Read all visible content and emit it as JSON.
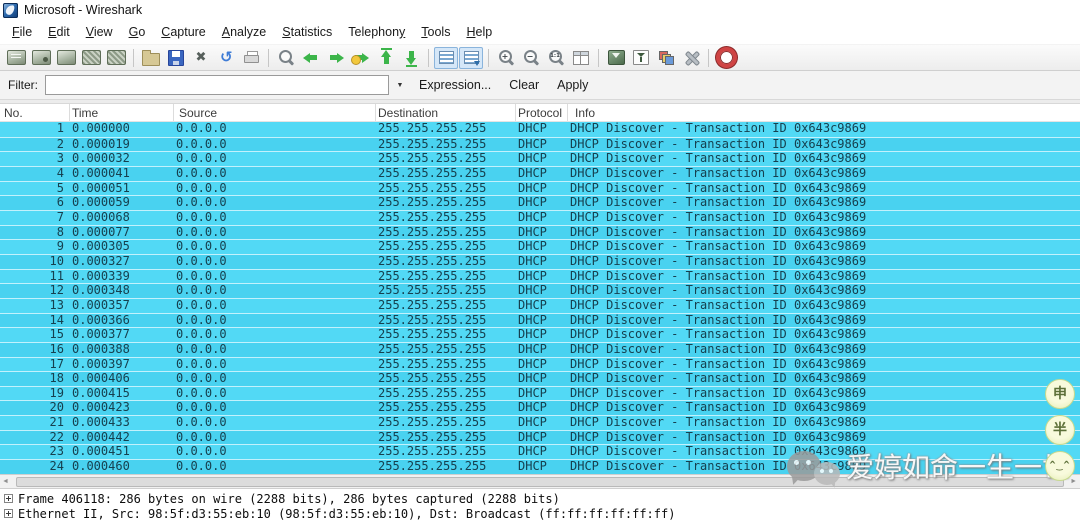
{
  "window": {
    "title": "Microsoft - Wireshark"
  },
  "menu": {
    "items": [
      {
        "label": "File",
        "underline": 0
      },
      {
        "label": "Edit",
        "underline": 0
      },
      {
        "label": "View",
        "underline": 0
      },
      {
        "label": "Go",
        "underline": 0
      },
      {
        "label": "Capture",
        "underline": 0
      },
      {
        "label": "Analyze",
        "underline": 0
      },
      {
        "label": "Statistics",
        "underline": 0
      },
      {
        "label": "Telephony",
        "underline": 8
      },
      {
        "label": "Tools",
        "underline": 0
      },
      {
        "label": "Help",
        "underline": 0
      }
    ]
  },
  "toolbar": {
    "buttons": [
      {
        "name": "list-interfaces",
        "type": "cap1"
      },
      {
        "name": "capture-options",
        "type": "cap2"
      },
      {
        "name": "capture-start",
        "type": "cap3"
      },
      {
        "name": "capture-stop",
        "type": "cap4"
      },
      {
        "name": "capture-restart",
        "type": "cap5"
      },
      {
        "type": "sep"
      },
      {
        "name": "open-capture-file",
        "type": "folder"
      },
      {
        "name": "save-capture-file",
        "type": "floppy"
      },
      {
        "name": "close-capture-file",
        "type": "close",
        "glyph": "✖"
      },
      {
        "name": "reload-capture-file",
        "type": "reload",
        "glyph": "↻"
      },
      {
        "name": "print-packets",
        "type": "printer"
      },
      {
        "type": "sep"
      },
      {
        "name": "find-packet",
        "type": "find"
      },
      {
        "name": "go-back",
        "type": "arrow-left"
      },
      {
        "name": "go-forward",
        "type": "arrow-right"
      },
      {
        "name": "go-to-packet",
        "type": "arrow-jump"
      },
      {
        "name": "go-first-packet",
        "type": "arrow-top"
      },
      {
        "name": "go-last-packet",
        "type": "arrow-bottom"
      },
      {
        "type": "sep"
      },
      {
        "name": "colorize-packet-list",
        "type": "toggle-colorize",
        "toggled": true
      },
      {
        "name": "auto-scroll-in-live-capture",
        "type": "toggle-autoscroll",
        "toggled": true
      },
      {
        "type": "sep"
      },
      {
        "name": "zoom-in",
        "type": "zoom",
        "glyph": "+"
      },
      {
        "name": "zoom-out",
        "type": "zoom",
        "glyph": "−"
      },
      {
        "name": "zoom-100",
        "type": "zoom",
        "glyph": "1:1"
      },
      {
        "name": "resize-columns",
        "type": "resize"
      },
      {
        "type": "sep"
      },
      {
        "name": "capture-filters",
        "type": "cfilter"
      },
      {
        "name": "display-filters",
        "type": "dfilter"
      },
      {
        "name": "coloring-rules",
        "type": "colrules"
      },
      {
        "name": "preferences",
        "type": "prefs"
      },
      {
        "type": "sep"
      },
      {
        "name": "help-contents",
        "type": "help"
      }
    ]
  },
  "filter_bar": {
    "label": "Filter:",
    "input_value": "",
    "dropdown_icon": "▼",
    "expression_label": "Expression...",
    "clear_label": "Clear",
    "apply_label": "Apply"
  },
  "packet_list": {
    "columns": [
      "No.",
      "Time",
      "Source",
      "Destination",
      "Protocol",
      "Info"
    ],
    "common": {
      "source": "0.0.0.0",
      "destination": "255.255.255.255",
      "protocol": "DHCP",
      "info": "DHCP Discover - Transaction ID 0x643c9869"
    },
    "rows": [
      {
        "no": "1",
        "time": "0.000000",
        "source": "0.0.0.0",
        "destination": "255.255.255.255",
        "protocol": "DHCP",
        "info": "DHCP Discover - Transaction ID 0x643c9869"
      },
      {
        "no": "2",
        "time": "0.000019",
        "source": "0.0.0.0",
        "destination": "255.255.255.255",
        "protocol": "DHCP",
        "info": "DHCP Discover - Transaction ID 0x643c9869"
      },
      {
        "no": "3",
        "time": "0.000032",
        "source": "0.0.0.0",
        "destination": "255.255.255.255",
        "protocol": "DHCP",
        "info": "DHCP Discover - Transaction ID 0x643c9869"
      },
      {
        "no": "4",
        "time": "0.000041",
        "source": "0.0.0.0",
        "destination": "255.255.255.255",
        "protocol": "DHCP",
        "info": "DHCP Discover - Transaction ID 0x643c9869"
      },
      {
        "no": "5",
        "time": "0.000051",
        "source": "0.0.0.0",
        "destination": "255.255.255.255",
        "protocol": "DHCP",
        "info": "DHCP Discover - Transaction ID 0x643c9869"
      },
      {
        "no": "6",
        "time": "0.000059",
        "source": "0.0.0.0",
        "destination": "255.255.255.255",
        "protocol": "DHCP",
        "info": "DHCP Discover - Transaction ID 0x643c9869"
      },
      {
        "no": "7",
        "time": "0.000068",
        "source": "0.0.0.0",
        "destination": "255.255.255.255",
        "protocol": "DHCP",
        "info": "DHCP Discover - Transaction ID 0x643c9869"
      },
      {
        "no": "8",
        "time": "0.000077",
        "source": "0.0.0.0",
        "destination": "255.255.255.255",
        "protocol": "DHCP",
        "info": "DHCP Discover - Transaction ID 0x643c9869"
      },
      {
        "no": "9",
        "time": "0.000305",
        "source": "0.0.0.0",
        "destination": "255.255.255.255",
        "protocol": "DHCP",
        "info": "DHCP Discover - Transaction ID 0x643c9869"
      },
      {
        "no": "10",
        "time": "0.000327",
        "source": "0.0.0.0",
        "destination": "255.255.255.255",
        "protocol": "DHCP",
        "info": "DHCP Discover - Transaction ID 0x643c9869"
      },
      {
        "no": "11",
        "time": "0.000339",
        "source": "0.0.0.0",
        "destination": "255.255.255.255",
        "protocol": "DHCP",
        "info": "DHCP Discover - Transaction ID 0x643c9869"
      },
      {
        "no": "12",
        "time": "0.000348",
        "source": "0.0.0.0",
        "destination": "255.255.255.255",
        "protocol": "DHCP",
        "info": "DHCP Discover - Transaction ID 0x643c9869"
      },
      {
        "no": "13",
        "time": "0.000357",
        "source": "0.0.0.0",
        "destination": "255.255.255.255",
        "protocol": "DHCP",
        "info": "DHCP Discover - Transaction ID 0x643c9869"
      },
      {
        "no": "14",
        "time": "0.000366",
        "source": "0.0.0.0",
        "destination": "255.255.255.255",
        "protocol": "DHCP",
        "info": "DHCP Discover - Transaction ID 0x643c9869"
      },
      {
        "no": "15",
        "time": "0.000377",
        "source": "0.0.0.0",
        "destination": "255.255.255.255",
        "protocol": "DHCP",
        "info": "DHCP Discover - Transaction ID 0x643c9869"
      },
      {
        "no": "16",
        "time": "0.000388",
        "source": "0.0.0.0",
        "destination": "255.255.255.255",
        "protocol": "DHCP",
        "info": "DHCP Discover - Transaction ID 0x643c9869"
      },
      {
        "no": "17",
        "time": "0.000397",
        "source": "0.0.0.0",
        "destination": "255.255.255.255",
        "protocol": "DHCP",
        "info": "DHCP Discover - Transaction ID 0x643c9869"
      },
      {
        "no": "18",
        "time": "0.000406",
        "source": "0.0.0.0",
        "destination": "255.255.255.255",
        "protocol": "DHCP",
        "info": "DHCP Discover - Transaction ID 0x643c9869"
      },
      {
        "no": "19",
        "time": "0.000415",
        "source": "0.0.0.0",
        "destination": "255.255.255.255",
        "protocol": "DHCP",
        "info": "DHCP Discover - Transaction ID 0x643c9869"
      },
      {
        "no": "20",
        "time": "0.000423",
        "source": "0.0.0.0",
        "destination": "255.255.255.255",
        "protocol": "DHCP",
        "info": "DHCP Discover - Transaction ID 0x643c9869"
      },
      {
        "no": "21",
        "time": "0.000433",
        "source": "0.0.0.0",
        "destination": "255.255.255.255",
        "protocol": "DHCP",
        "info": "DHCP Discover - Transaction ID 0x643c9869"
      },
      {
        "no": "22",
        "time": "0.000442",
        "source": "0.0.0.0",
        "destination": "255.255.255.255",
        "protocol": "DHCP",
        "info": "DHCP Discover - Transaction ID 0x643c9869"
      },
      {
        "no": "23",
        "time": "0.000451",
        "source": "0.0.0.0",
        "destination": "255.255.255.255",
        "protocol": "DHCP",
        "info": "DHCP Discover - Transaction ID 0x643c9869"
      },
      {
        "no": "24",
        "time": "0.000460",
        "source": "0.0.0.0",
        "destination": "255.255.255.255",
        "protocol": "DHCP",
        "info": "DHCP Discover - Transaction ID 0x643c9869"
      }
    ]
  },
  "hscrollbar": {
    "left_arrow": "◄",
    "right_arrow": "►"
  },
  "detail_pane": {
    "lines": [
      {
        "text": "Frame 406118: 286 bytes on wire (2288 bits), 286 bytes captured (2288 bits)"
      },
      {
        "text": "Ethernet II, Src: 98:5f:d3:55:eb:10 (98:5f:d3:55:eb:10), Dst: Broadcast (ff:ff:ff:ff:ff:ff)"
      }
    ]
  },
  "watermark": {
    "text": "爱婷如命一生一世",
    "stamps": [
      {
        "char": "申"
      },
      {
        "char": "半"
      },
      {
        "char": "^‿^",
        "face": true
      }
    ]
  },
  "colors": {
    "row_cyan": "#52d9f5",
    "row_cyan_alt": "#49d2f0",
    "row_separator": "#c2f1fc",
    "row_text": "#16404f",
    "toggle_highlight": "#d5e7f8",
    "arrow_green": "#3cb54a",
    "help_red": "#cf4444",
    "stamp_yellow": "#f0f5c2"
  }
}
